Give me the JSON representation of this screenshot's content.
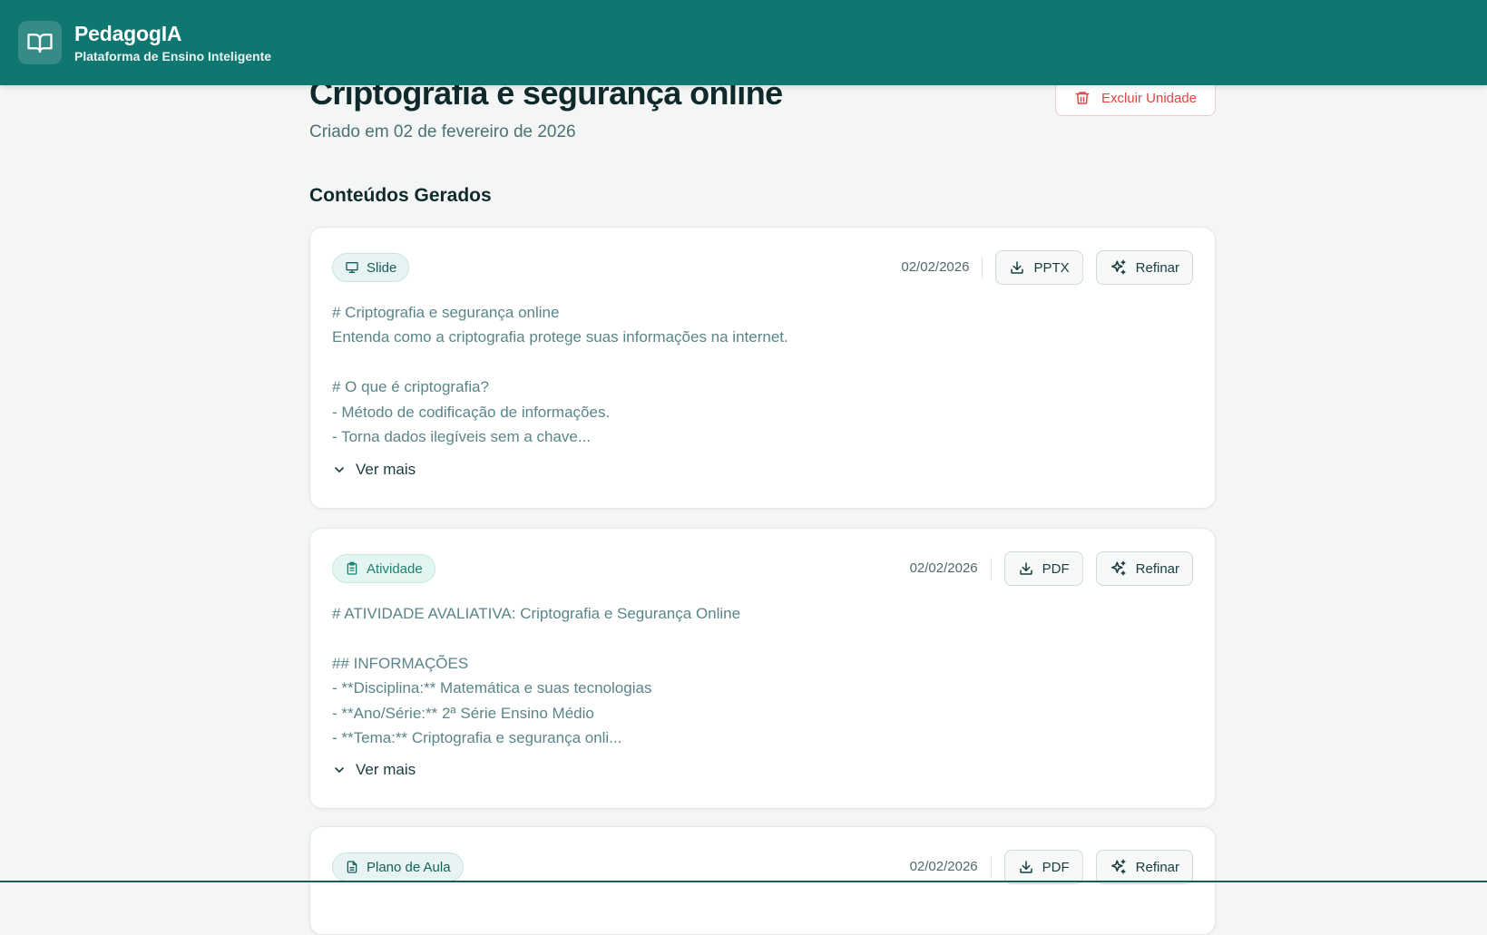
{
  "header": {
    "brand_name": "PedagogIA",
    "tagline": "Plataforma de Ensino Inteligente",
    "logo_icon": "open-book-icon",
    "background_color": "#0f7670"
  },
  "page": {
    "title": "Criptografia e segurança online",
    "created_at": "Criado em 02 de fevereiro de 2026",
    "delete_label": "Excluir Unidade",
    "delete_icon": "trash-icon"
  },
  "section": {
    "title": "Conteúdos Gerados"
  },
  "contents": [
    {
      "type_label": "Slide",
      "type_icon": "presentation-icon",
      "date": "02/02/2026",
      "export_label": "PPTX",
      "refine_label": "Refinar",
      "body": "# Criptografia e segurança online\nEntenda como a criptografia protege suas informações na internet.\n\n# O que é criptografia?\n- Método de codificação de informações.\n- Torna dados ilegíveis sem a chave...",
      "see_more_label": "Ver mais"
    },
    {
      "type_label": "Atividade",
      "type_icon": "clipboard-icon",
      "date": "02/02/2026",
      "export_label": "PDF",
      "refine_label": "Refinar",
      "body": "# ATIVIDADE AVALIATIVA: Criptografia e Segurança Online\n\n## INFORMAÇÕES\n- **Disciplina:** Matemática e suas tecnologias\n- **Ano/Série:** 2ª Série Ensino Médio\n- **Tema:** Criptografia e segurança onli...",
      "see_more_label": "Ver mais"
    },
    {
      "type_label": "Plano de Aula",
      "type_icon": "document-icon",
      "date": "02/02/2026",
      "export_label": "PDF",
      "refine_label": "Refinar"
    }
  ],
  "colors": {
    "accent": "#0f7670",
    "danger": "#e04444",
    "body_text": "#5a8589"
  }
}
